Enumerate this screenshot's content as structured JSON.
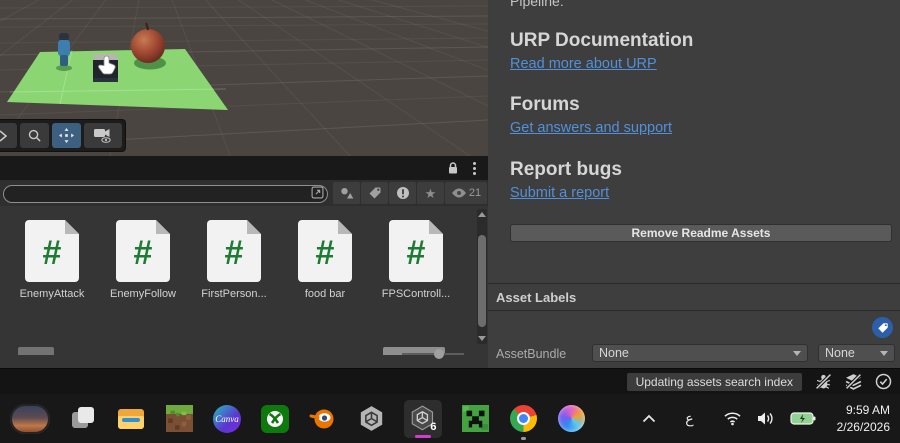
{
  "scene_view": {
    "toolbar": {
      "tools": [
        "cursor-tool",
        "zoom-tool",
        "pan-tool",
        "camera-tool"
      ],
      "active_tool": "pan-tool"
    },
    "objects": [
      "player-character",
      "pickup-cube",
      "apple",
      "ground-plane"
    ],
    "colors": {
      "background": "#4a4540",
      "ground_plane": "#8bd673",
      "grid_line": "#8a8276"
    }
  },
  "project_panel": {
    "header_icons": [
      "lock-icon",
      "kebab-menu-icon"
    ],
    "filter_bar": {
      "search_value": "",
      "icons": [
        "expand-icon",
        "filter-by-type-icon",
        "filter-by-label-icon",
        "alert-icon",
        "favorites-star-icon",
        "eye-icon"
      ],
      "hidden_count": "21"
    },
    "items": [
      {
        "label": "EnemyAttack",
        "type": "csharp-script"
      },
      {
        "label": "EnemyFollow",
        "type": "csharp-script"
      },
      {
        "label": "FirstPerson...",
        "type": "csharp-script"
      },
      {
        "label": "food bar",
        "type": "csharp-script"
      },
      {
        "label": "FPSControll...",
        "type": "csharp-script"
      }
    ],
    "script_icon_color": "#1e7b34"
  },
  "inspector": {
    "pipeline_text": "Pipeline:",
    "sections": [
      {
        "heading": "URP Documentation",
        "link": "Read more about URP"
      },
      {
        "heading": "Forums",
        "link": "Get answers and support"
      },
      {
        "heading": "Report bugs",
        "link": "Submit a report"
      }
    ],
    "remove_button_label": "Remove Readme Assets",
    "asset_labels_header": "Asset Labels",
    "assetbundle_label": "AssetBundle",
    "assetbundle_value": "None",
    "assetbundle_variant_value": "None",
    "link_color": "#5290d9",
    "tag_button_color": "#2c5fa8"
  },
  "status_bar": {
    "message": "Updating assets search index",
    "icons": [
      "debugger-off-icon",
      "cache-off-icon",
      "status-ok-icon"
    ]
  },
  "taskbar": {
    "pinned_apps": [
      "widgets",
      "task-view",
      "file-explorer",
      "minecraft",
      "canva",
      "xbox",
      "blender",
      "unity-hub",
      "unity-6",
      "minecraft-creeper",
      "chrome",
      "copilot"
    ],
    "active_app": "unity-6",
    "canva_label": "Canva",
    "unity_version_label": "6",
    "tray": {
      "language_indicator": "ع",
      "icons": [
        "hidden-icons-chevron",
        "wifi-icon",
        "volume-icon",
        "battery-charging-icon"
      ],
      "time": "9:59 AM",
      "date": "2/26/2026"
    },
    "active_underline_color": "#cf3ecf"
  }
}
